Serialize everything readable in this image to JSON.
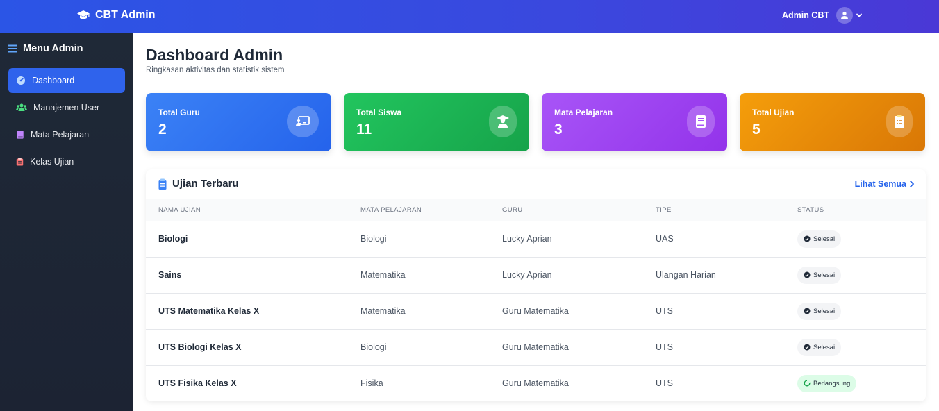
{
  "app": {
    "brand": "CBT Admin",
    "user_name": "Admin CBT"
  },
  "sidebar": {
    "title": "Menu Admin",
    "items": [
      {
        "label": "Dashboard",
        "icon": "gauge-icon",
        "active": true
      },
      {
        "label": "Manajemen User",
        "icon": "users-icon",
        "active": false
      },
      {
        "label": "Mata Pelajaran",
        "icon": "book-icon",
        "active": false
      },
      {
        "label": "Kelas Ujian",
        "icon": "clipboard-icon",
        "active": false
      }
    ]
  },
  "header": {
    "title": "Dashboard Admin",
    "subtitle": "Ringkasan aktivitas dan statistik sistem"
  },
  "stats": [
    {
      "label": "Total Guru",
      "value": "2",
      "icon": "teacher-icon",
      "color": "#2563eb"
    },
    {
      "label": "Total Siswa",
      "value": "11",
      "icon": "graduate-icon",
      "color": "#16a34a"
    },
    {
      "label": "Mata Pelajaran",
      "value": "3",
      "icon": "book-icon",
      "color": "#9333ea"
    },
    {
      "label": "Total Ujian",
      "value": "5",
      "icon": "clipboard-icon",
      "color": "#d97706"
    }
  ],
  "recent": {
    "title": "Ujian Terbaru",
    "see_all": "Lihat Semua",
    "columns": [
      "NAMA UJIAN",
      "MATA PELAJARAN",
      "GURU",
      "TIPE",
      "STATUS"
    ],
    "rows": [
      {
        "name": "Biologi",
        "subject": "Biologi",
        "teacher": "Lucky Aprian",
        "type": "UAS",
        "status": "Selesai"
      },
      {
        "name": "Sains",
        "subject": "Matematika",
        "teacher": "Lucky Aprian",
        "type": "Ulangan Harian",
        "status": "Selesai"
      },
      {
        "name": "UTS Matematika Kelas X",
        "subject": "Matematika",
        "teacher": "Guru Matematika",
        "type": "UTS",
        "status": "Selesai"
      },
      {
        "name": "UTS Biologi Kelas X",
        "subject": "Biologi",
        "teacher": "Guru Matematika",
        "type": "UTS",
        "status": "Selesai"
      },
      {
        "name": "UTS Fisika Kelas X",
        "subject": "Fisika",
        "teacher": "Guru Matematika",
        "type": "UTS",
        "status": "Berlangsung"
      }
    ]
  }
}
